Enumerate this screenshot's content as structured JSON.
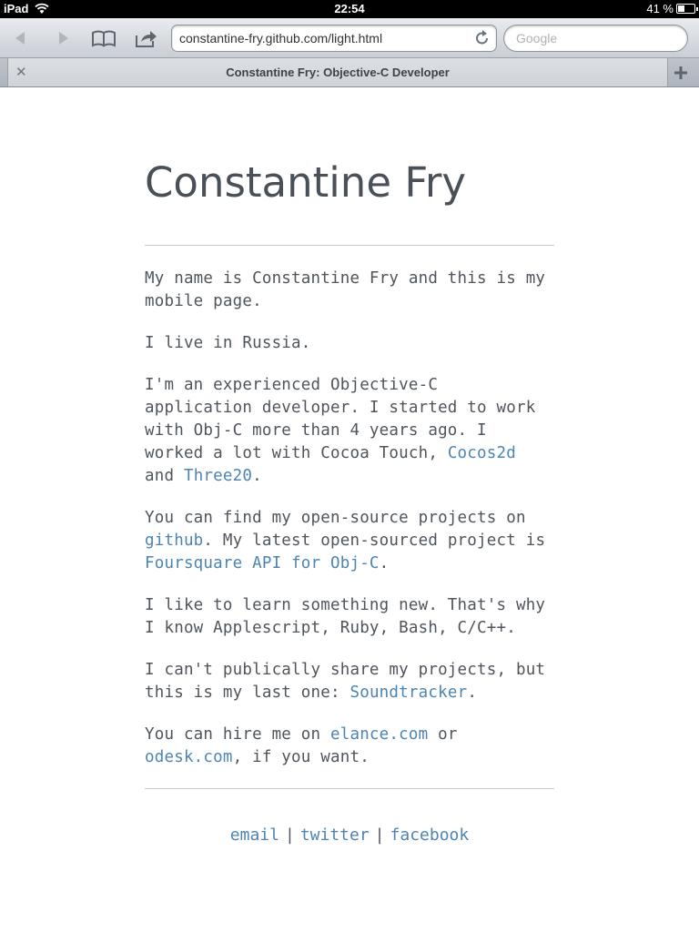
{
  "status_bar": {
    "device": "iPad",
    "time": "22:54",
    "battery": "41 %",
    "battery_level": 0.41
  },
  "toolbar": {
    "back_icon": "back-arrow-icon",
    "forward_icon": "forward-arrow-icon",
    "bookmarks_icon": "book-icon",
    "share_icon": "share-icon",
    "url": "constantine-fry.github.com/light.html",
    "reload_icon": "reload-icon",
    "search_placeholder": "Google"
  },
  "tab": {
    "title": "Constantine Fry: Objective-C Developer"
  },
  "page": {
    "title": "Constantine Fry",
    "p1": "My name is Constantine Fry and this is my mobile page.",
    "p2": "I live in Russia.",
    "p3_a": "I'm an experienced Objective-C application developer. I started to work with Obj-C more than 4 years ago. I worked a lot with Cocoa Touch, ",
    "p3_link1": "Cocos2d",
    "p3_b": " and ",
    "p3_link2": "Three20",
    "p3_c": ".",
    "p4_a": "You can find my open-source projects on ",
    "p4_link1": "github",
    "p4_b": ". My latest open-sourced project is ",
    "p4_link2": "Foursquare API for Obj-C",
    "p4_c": ".",
    "p5": "I like to learn something new. That's why I know Applescript, Ruby, Bash, C/C++.",
    "p6_a": "I can't publically share my projects, but this is my last one: ",
    "p6_link": "Soundtracker",
    "p6_b": ".",
    "p7_a": "You can hire me on ",
    "p7_link1": "elance.com",
    "p7_b": " or ",
    "p7_link2": "odesk.com",
    "p7_c": ", if you want."
  },
  "footer": {
    "email": "email",
    "twitter": "twitter",
    "facebook": "facebook",
    "separator": "|"
  }
}
